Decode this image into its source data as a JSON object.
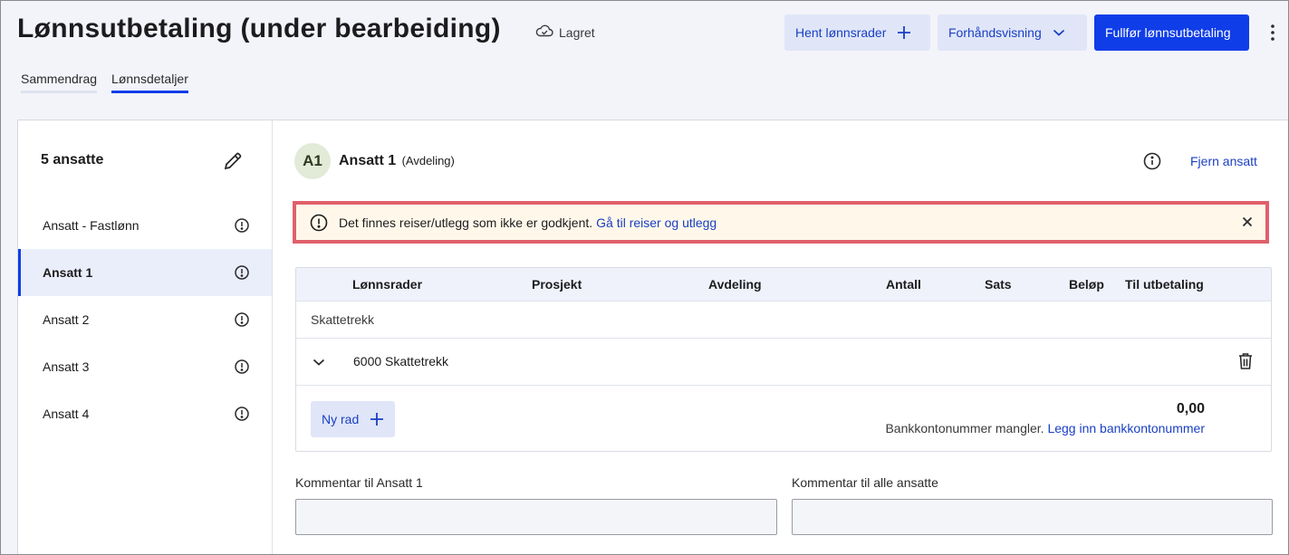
{
  "header": {
    "title": "Lønnsutbetaling (under bearbeiding)",
    "saved_status": "Lagret",
    "fetch_rows_label": "Hent lønnsrader",
    "preview_label": "Forhåndsvisning",
    "complete_label": "Fullfør lønnsutbetaling"
  },
  "tabs": [
    {
      "label": "Sammendrag",
      "active": false
    },
    {
      "label": "Lønnsdetaljer",
      "active": true
    }
  ],
  "sidebar": {
    "header": "5 ansatte",
    "employees": [
      {
        "label": "Ansatt - Fastlønn"
      },
      {
        "label": "Ansatt 1"
      },
      {
        "label": "Ansatt 2"
      },
      {
        "label": "Ansatt 3"
      },
      {
        "label": "Ansatt 4"
      }
    ]
  },
  "employee": {
    "initials": "A1",
    "name": "Ansatt 1",
    "department": "(Avdeling)",
    "remove_label": "Fjern ansatt"
  },
  "alert": {
    "text": "Det finnes reiser/utlegg som ikke er godkjent.",
    "link": "Gå til reiser og utlegg"
  },
  "table": {
    "columns": [
      "Lønnsrader",
      "Prosjekt",
      "Avdeling",
      "Antall",
      "Sats",
      "Beløp",
      "Til utbetaling"
    ],
    "group": "Skattetrekk",
    "row": "6000 Skattetrekk",
    "new_row_label": "Ny rad",
    "total": "0,00",
    "bank_note": "Bankkontonummer mangler.",
    "bank_link": "Legg inn bankkontonummer"
  },
  "comments": {
    "employee_label": "Kommentar til Ansatt 1",
    "all_label": "Kommentar til alle ansatte"
  },
  "colors": {
    "primary": "#0f3de8",
    "link": "#1a3fc4",
    "alert_border": "#e0606b",
    "alert_bg": "#fff8ea"
  }
}
